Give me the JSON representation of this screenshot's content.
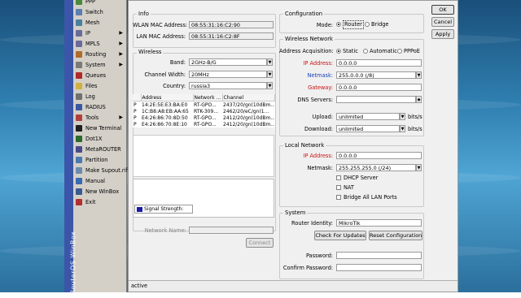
{
  "sidebar": {
    "brand": "RouterOS WinBox",
    "items": [
      {
        "label": "PPP",
        "icon": "ppp-icon",
        "color": "#4a8a3a",
        "arrow": false
      },
      {
        "label": "Switch",
        "icon": "switch-icon",
        "color": "#5a7fb0",
        "arrow": false
      },
      {
        "label": "Mesh",
        "icon": "mesh-icon",
        "color": "#4a7fa0",
        "arrow": false
      },
      {
        "label": "IP",
        "icon": "ip-icon",
        "color": "#6a6a9a",
        "arrow": true
      },
      {
        "label": "MPLS",
        "icon": "mpls-icon",
        "color": "#6a6a9a",
        "arrow": true
      },
      {
        "label": "Routing",
        "icon": "routing-icon",
        "color": "#b06a2a",
        "arrow": true
      },
      {
        "label": "System",
        "icon": "system-icon",
        "color": "#7a7a7a",
        "arrow": true
      },
      {
        "label": "Queues",
        "icon": "queues-icon",
        "color": "#b02a2a",
        "arrow": false
      },
      {
        "label": "Files",
        "icon": "files-icon",
        "color": "#d0b040",
        "arrow": false
      },
      {
        "label": "Log",
        "icon": "log-icon",
        "color": "#707070",
        "arrow": false
      },
      {
        "label": "RADIUS",
        "icon": "radius-icon",
        "color": "#3a5aa0",
        "arrow": false
      },
      {
        "label": "Tools",
        "icon": "tools-icon",
        "color": "#b04040",
        "arrow": true
      },
      {
        "label": "New Terminal",
        "icon": "terminal-icon",
        "color": "#202020",
        "arrow": false
      },
      {
        "label": "Dot1X",
        "icon": "dot1x-icon",
        "color": "#2a6a2a",
        "arrow": false
      },
      {
        "label": "MetaROUTER",
        "icon": "metarouter-icon",
        "color": "#4a4a8a",
        "arrow": false
      },
      {
        "label": "Partition",
        "icon": "partition-icon",
        "color": "#4a7ab0",
        "arrow": false
      },
      {
        "label": "Make Supout.rif",
        "icon": "supout-icon",
        "color": "#6a8ab0",
        "arrow": false
      },
      {
        "label": "Manual",
        "icon": "manual-icon",
        "color": "#3a6ab0",
        "arrow": false
      },
      {
        "label": "New WinBox",
        "icon": "winbox-icon",
        "color": "#3a5a90",
        "arrow": false
      },
      {
        "label": "Exit",
        "icon": "exit-icon",
        "color": "#b03030",
        "arrow": false
      }
    ]
  },
  "info": {
    "title": "Info",
    "wlan_mac_label": "WLAN MAC Address:",
    "wlan_mac": "08:55:31:16:C2:90",
    "lan_mac_label": "LAN MAC Address:",
    "lan_mac": "08:55:31:16:C2:8F"
  },
  "wireless": {
    "title": "Wireless",
    "band_label": "Band:",
    "band": "2GHz-B/G",
    "width_label": "Channel Width:",
    "width": "20MHz",
    "country_label": "Country:",
    "country": "russia3",
    "columns": [
      "",
      "Address",
      "Network ...",
      "Channel"
    ],
    "rows": [
      [
        "P",
        "14:2E:5E:E3:BA:E0",
        "RT-GPO...",
        "2437/20/gn(10dBm..."
      ],
      [
        "P",
        "1C:B8:A8:EB:AA:65",
        "RTK-309...",
        "2462/20/eC/gn(1..."
      ],
      [
        "P",
        "E4:26:86:70:8D:50",
        "RT-GPO...",
        "2412/20/gn(10dBm..."
      ],
      [
        "P",
        "E4:26:86:70:8E:10",
        "RT-GPO...",
        "2412/20/gn(10dBm..."
      ]
    ],
    "signal_label": "Signal Strength:",
    "signal_color": "#1a1aa8",
    "network_name_label": "Network Name:",
    "network_name": "",
    "connect_button": "Connect"
  },
  "configuration": {
    "title": "Configuration",
    "mode_label": "Mode:",
    "mode_router": "Router",
    "mode_bridge": "Bridge",
    "selected_mode": "Router"
  },
  "wireless_network": {
    "title": "Wireless Network",
    "acq_label": "Address Acquisition:",
    "acq_static": "Static",
    "acq_auto": "Automatic",
    "acq_pppoe": "PPPoE",
    "selected_acq": "Static",
    "ip_label": "IP Address:",
    "ip": "0.0.0.0",
    "netmask_label": "Netmask:",
    "netmask": "255.0.0.0 (/8)",
    "gateway_label": "Gateway:",
    "gateway": "0.0.0.0",
    "dns_label": "DNS Servers:",
    "dns": "",
    "upload_label": "Upload:",
    "upload": "unlimited",
    "download_label": "Download:",
    "download": "unlimited",
    "unit": "bits/s"
  },
  "local_network": {
    "title": "Local Network",
    "ip_label": "IP Address:",
    "ip": "0.0.0.0",
    "netmask_label": "Netmask:",
    "netmask": "255.255.255.0 (/24)",
    "dhcp_label": "DHCP Server",
    "nat_label": "NAT",
    "bridge_label": "Bridge All LAN Ports"
  },
  "system": {
    "title": "System",
    "identity_label": "Router Identity:",
    "identity": "MikroTik",
    "check_updates": "Check For Updates",
    "reset": "Reset Configuration",
    "password_label": "Password:",
    "confirm_label": "Confirm Password:"
  },
  "buttons": {
    "ok": "OK",
    "cancel": "Cancel",
    "apply": "Apply"
  },
  "status": "active"
}
